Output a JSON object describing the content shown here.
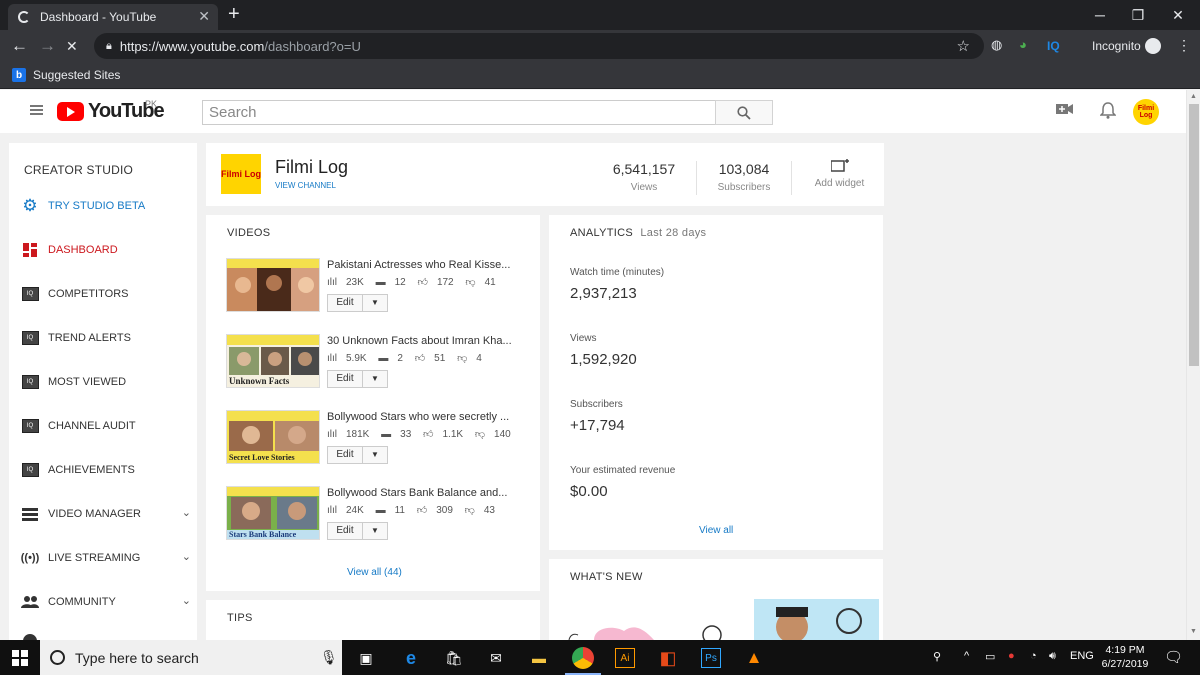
{
  "browser": {
    "tab_title": "Dashboard - YouTube",
    "url_host": "https://www.youtube.com",
    "url_path": "/dashboard?o=U",
    "profile": "Incognito",
    "ext_iq": "IQ",
    "bookmark": "Suggested Sites"
  },
  "header": {
    "logo_text": "YouTube",
    "region": "PK",
    "search_placeholder": "Search"
  },
  "sidebar": {
    "title": "CREATOR STUDIO",
    "items": [
      {
        "label": "TRY STUDIO BETA",
        "color": "#167ac6"
      },
      {
        "label": "DASHBOARD",
        "color": "#cc181e"
      },
      {
        "label": "COMPETITORS"
      },
      {
        "label": "TREND ALERTS"
      },
      {
        "label": "MOST VIEWED"
      },
      {
        "label": "CHANNEL AUDIT"
      },
      {
        "label": "ACHIEVEMENTS"
      },
      {
        "label": "VIDEO MANAGER"
      },
      {
        "label": "LIVE STREAMING"
      },
      {
        "label": "COMMUNITY"
      }
    ]
  },
  "channel": {
    "name": "Filmi Log",
    "view_channel": "VIEW CHANNEL",
    "logo_text": "Filmi Log",
    "views_value": "6,541,157",
    "views_label": "Views",
    "subs_value": "103,084",
    "subs_label": "Subscribers",
    "add_widget": "Add widget"
  },
  "videos": {
    "heading": "VIDEOS",
    "edit_label": "Edit",
    "view_all": "View all (44)",
    "items": [
      {
        "title": "Pakistani Actresses who Real Kisse...",
        "views": "23K",
        "comments": "12",
        "likes": "172",
        "dislikes": "41"
      },
      {
        "title": "30 Unknown Facts about Imran Kha...",
        "views": "5.9K",
        "comments": "2",
        "likes": "51",
        "dislikes": "4",
        "thumb_caption": "Unknown Facts"
      },
      {
        "title": "Bollywood Stars who were secretly ...",
        "views": "181K",
        "comments": "33",
        "likes": "1.1K",
        "dislikes": "140",
        "thumb_caption": "Secret Love Stories"
      },
      {
        "title": "Bollywood Stars Bank Balance and...",
        "views": "24K",
        "comments": "11",
        "likes": "309",
        "dislikes": "43",
        "thumb_caption": "Stars Bank Balance"
      }
    ]
  },
  "analytics": {
    "heading": "ANALYTICS",
    "period": "Last 28 days",
    "watch_label": "Watch time (minutes)",
    "watch_value": "2,937,213",
    "views_label": "Views",
    "views_value": "1,592,920",
    "subs_label": "Subscribers",
    "subs_value": "+17,794",
    "revenue_label": "Your estimated revenue",
    "revenue_value": "$0.00",
    "view_all": "View all"
  },
  "whats_new": {
    "heading": "WHAT'S NEW"
  },
  "tips": {
    "heading": "TIPS"
  },
  "taskbar": {
    "search_placeholder": "Type here to search",
    "lang": "ENG",
    "time": "4:19 PM",
    "date": "6/27/2019"
  }
}
